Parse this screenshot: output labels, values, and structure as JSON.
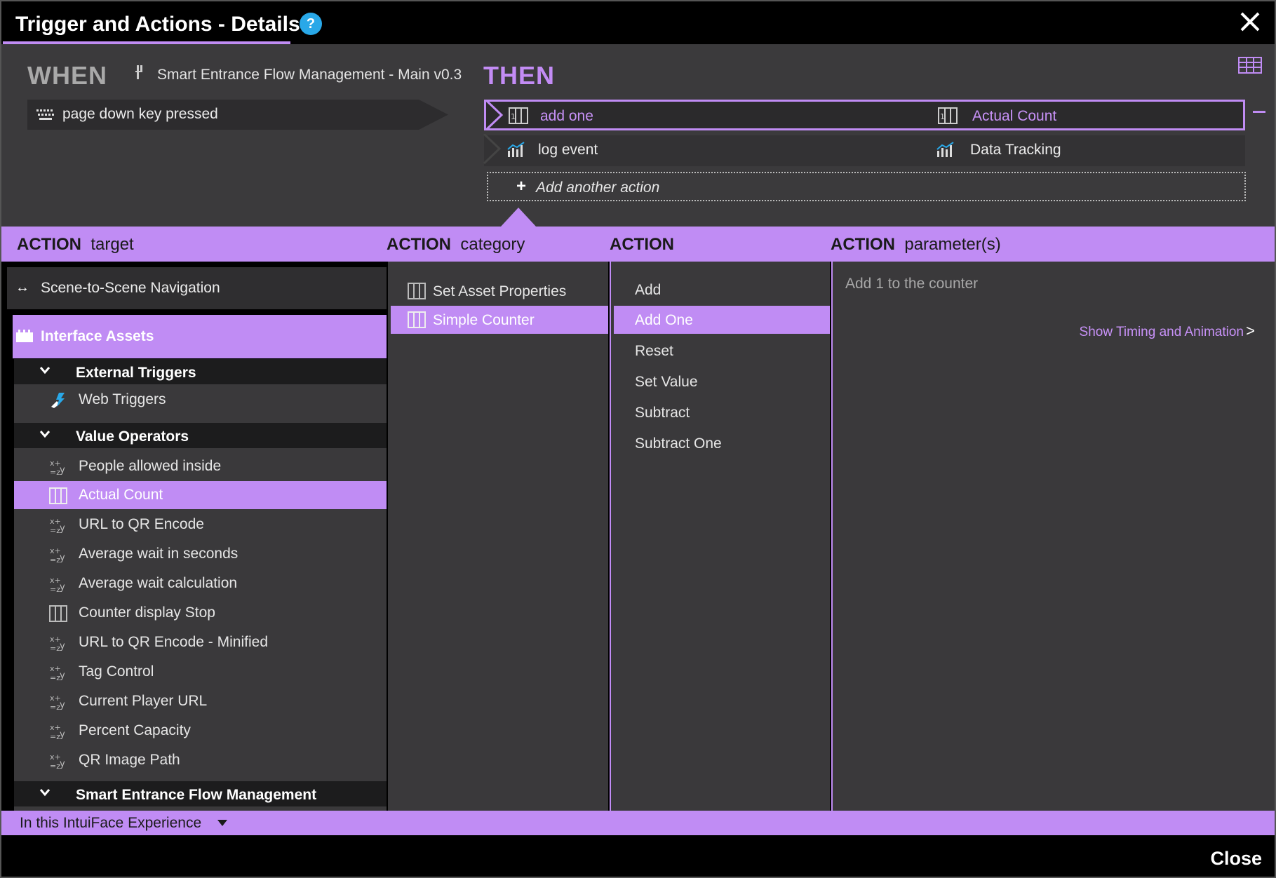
{
  "window": {
    "title": "Trigger and Actions - Details",
    "help_icon": "?",
    "close_icon": "close-icon"
  },
  "when": {
    "label": "WHEN",
    "source": "Smart Entrance Flow Management - Main v0.3",
    "trigger": "page down key pressed"
  },
  "then": {
    "label": "THEN",
    "actions": [
      {
        "name": "add one",
        "target": "Actual Count",
        "selected": true,
        "icon": "counter-icon"
      },
      {
        "name": "log event",
        "target": "Data Tracking",
        "selected": false,
        "icon": "chart-icon"
      }
    ],
    "add_action_plus": "+",
    "add_action": "Add another action"
  },
  "headers": {
    "target_bold": "ACTION",
    "target_rest": "target",
    "category_bold": "ACTION",
    "category_rest": "category",
    "action_bold": "ACTION",
    "params_bold": "ACTION",
    "params_rest": "parameter(s)"
  },
  "targets": {
    "nav": "Scene-to-Scene Navigation",
    "nav_arrows": "↔",
    "interface_assets": "Interface Assets",
    "groups": [
      {
        "label": "External Triggers",
        "caret": "⌄"
      },
      {
        "label": "Value Operators",
        "caret": "⌄"
      },
      {
        "label": "Smart Entrance Flow Management",
        "caret": "⌄"
      }
    ],
    "external_items": [
      {
        "label": "Web Triggers",
        "icon": "web-trigger-icon"
      }
    ],
    "value_items": [
      {
        "label": "People allowed inside",
        "icon": "variable-icon",
        "selected": false
      },
      {
        "label": "Actual Count",
        "icon": "counter-icon",
        "selected": true
      },
      {
        "label": "URL to QR Encode",
        "icon": "variable-icon",
        "selected": false
      },
      {
        "label": "Average wait in seconds",
        "icon": "variable-icon",
        "selected": false
      },
      {
        "label": "Average wait calculation",
        "icon": "variable-icon",
        "selected": false
      },
      {
        "label": "Counter display Stop",
        "icon": "counter-icon",
        "selected": false
      },
      {
        "label": "URL to QR Encode - Minified",
        "icon": "variable-icon",
        "selected": false
      },
      {
        "label": "Tag Control",
        "icon": "variable-icon",
        "selected": false
      },
      {
        "label": "Current Player URL",
        "icon": "variable-icon",
        "selected": false
      },
      {
        "label": "Percent Capacity",
        "icon": "variable-icon",
        "selected": false
      },
      {
        "label": "QR Image Path",
        "icon": "variable-icon",
        "selected": false
      }
    ]
  },
  "categories": [
    {
      "label": "Set Asset Properties",
      "selected": false
    },
    {
      "label": "Simple Counter",
      "selected": true
    }
  ],
  "actions": [
    {
      "label": "Add",
      "selected": false
    },
    {
      "label": "Add One",
      "selected": true
    },
    {
      "label": "Reset",
      "selected": false
    },
    {
      "label": "Set Value",
      "selected": false
    },
    {
      "label": "Subtract",
      "selected": false
    },
    {
      "label": "Subtract One",
      "selected": false
    }
  ],
  "parameters": {
    "description": "Add 1 to the counter",
    "timing_link": "Show Timing and Animation",
    "timing_chevron": ">"
  },
  "scope": {
    "label": "In this IntuiFace Experience"
  },
  "footer": {
    "close": "Close"
  },
  "colors": {
    "accent": "#c08cf4",
    "panel": "#3a393b",
    "help": "#29a8e8"
  }
}
